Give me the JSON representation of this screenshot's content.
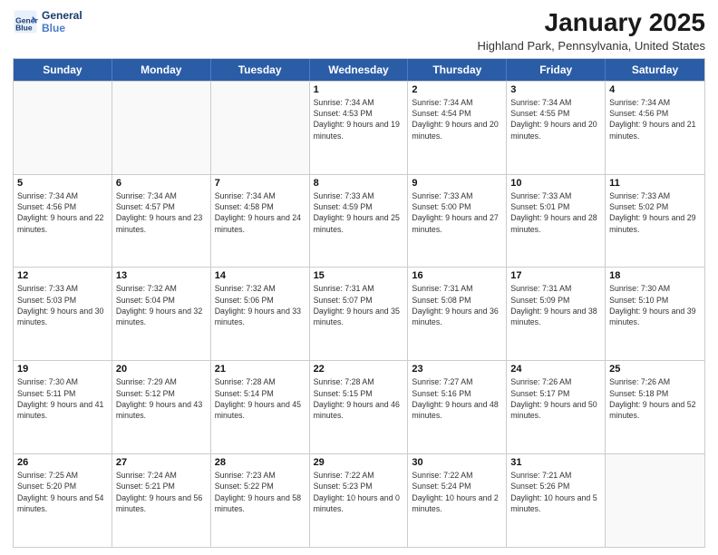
{
  "header": {
    "logo_line1": "General",
    "logo_line2": "Blue",
    "month_title": "January 2025",
    "location": "Highland Park, Pennsylvania, United States"
  },
  "weekdays": [
    "Sunday",
    "Monday",
    "Tuesday",
    "Wednesday",
    "Thursday",
    "Friday",
    "Saturday"
  ],
  "rows": [
    [
      {
        "day": "",
        "empty": true
      },
      {
        "day": "",
        "empty": true
      },
      {
        "day": "",
        "empty": true
      },
      {
        "day": "1",
        "sunrise": "7:34 AM",
        "sunset": "4:53 PM",
        "daylight": "9 hours and 19 minutes."
      },
      {
        "day": "2",
        "sunrise": "7:34 AM",
        "sunset": "4:54 PM",
        "daylight": "9 hours and 20 minutes."
      },
      {
        "day": "3",
        "sunrise": "7:34 AM",
        "sunset": "4:55 PM",
        "daylight": "9 hours and 20 minutes."
      },
      {
        "day": "4",
        "sunrise": "7:34 AM",
        "sunset": "4:56 PM",
        "daylight": "9 hours and 21 minutes."
      }
    ],
    [
      {
        "day": "5",
        "sunrise": "7:34 AM",
        "sunset": "4:56 PM",
        "daylight": "9 hours and 22 minutes."
      },
      {
        "day": "6",
        "sunrise": "7:34 AM",
        "sunset": "4:57 PM",
        "daylight": "9 hours and 23 minutes."
      },
      {
        "day": "7",
        "sunrise": "7:34 AM",
        "sunset": "4:58 PM",
        "daylight": "9 hours and 24 minutes."
      },
      {
        "day": "8",
        "sunrise": "7:33 AM",
        "sunset": "4:59 PM",
        "daylight": "9 hours and 25 minutes."
      },
      {
        "day": "9",
        "sunrise": "7:33 AM",
        "sunset": "5:00 PM",
        "daylight": "9 hours and 27 minutes."
      },
      {
        "day": "10",
        "sunrise": "7:33 AM",
        "sunset": "5:01 PM",
        "daylight": "9 hours and 28 minutes."
      },
      {
        "day": "11",
        "sunrise": "7:33 AM",
        "sunset": "5:02 PM",
        "daylight": "9 hours and 29 minutes."
      }
    ],
    [
      {
        "day": "12",
        "sunrise": "7:33 AM",
        "sunset": "5:03 PM",
        "daylight": "9 hours and 30 minutes."
      },
      {
        "day": "13",
        "sunrise": "7:32 AM",
        "sunset": "5:04 PM",
        "daylight": "9 hours and 32 minutes."
      },
      {
        "day": "14",
        "sunrise": "7:32 AM",
        "sunset": "5:06 PM",
        "daylight": "9 hours and 33 minutes."
      },
      {
        "day": "15",
        "sunrise": "7:31 AM",
        "sunset": "5:07 PM",
        "daylight": "9 hours and 35 minutes."
      },
      {
        "day": "16",
        "sunrise": "7:31 AM",
        "sunset": "5:08 PM",
        "daylight": "9 hours and 36 minutes."
      },
      {
        "day": "17",
        "sunrise": "7:31 AM",
        "sunset": "5:09 PM",
        "daylight": "9 hours and 38 minutes."
      },
      {
        "day": "18",
        "sunrise": "7:30 AM",
        "sunset": "5:10 PM",
        "daylight": "9 hours and 39 minutes."
      }
    ],
    [
      {
        "day": "19",
        "sunrise": "7:30 AM",
        "sunset": "5:11 PM",
        "daylight": "9 hours and 41 minutes."
      },
      {
        "day": "20",
        "sunrise": "7:29 AM",
        "sunset": "5:12 PM",
        "daylight": "9 hours and 43 minutes."
      },
      {
        "day": "21",
        "sunrise": "7:28 AM",
        "sunset": "5:14 PM",
        "daylight": "9 hours and 45 minutes."
      },
      {
        "day": "22",
        "sunrise": "7:28 AM",
        "sunset": "5:15 PM",
        "daylight": "9 hours and 46 minutes."
      },
      {
        "day": "23",
        "sunrise": "7:27 AM",
        "sunset": "5:16 PM",
        "daylight": "9 hours and 48 minutes."
      },
      {
        "day": "24",
        "sunrise": "7:26 AM",
        "sunset": "5:17 PM",
        "daylight": "9 hours and 50 minutes."
      },
      {
        "day": "25",
        "sunrise": "7:26 AM",
        "sunset": "5:18 PM",
        "daylight": "9 hours and 52 minutes."
      }
    ],
    [
      {
        "day": "26",
        "sunrise": "7:25 AM",
        "sunset": "5:20 PM",
        "daylight": "9 hours and 54 minutes."
      },
      {
        "day": "27",
        "sunrise": "7:24 AM",
        "sunset": "5:21 PM",
        "daylight": "9 hours and 56 minutes."
      },
      {
        "day": "28",
        "sunrise": "7:23 AM",
        "sunset": "5:22 PM",
        "daylight": "9 hours and 58 minutes."
      },
      {
        "day": "29",
        "sunrise": "7:22 AM",
        "sunset": "5:23 PM",
        "daylight": "10 hours and 0 minutes."
      },
      {
        "day": "30",
        "sunrise": "7:22 AM",
        "sunset": "5:24 PM",
        "daylight": "10 hours and 2 minutes."
      },
      {
        "day": "31",
        "sunrise": "7:21 AM",
        "sunset": "5:26 PM",
        "daylight": "10 hours and 5 minutes."
      },
      {
        "day": "",
        "empty": true
      }
    ]
  ]
}
